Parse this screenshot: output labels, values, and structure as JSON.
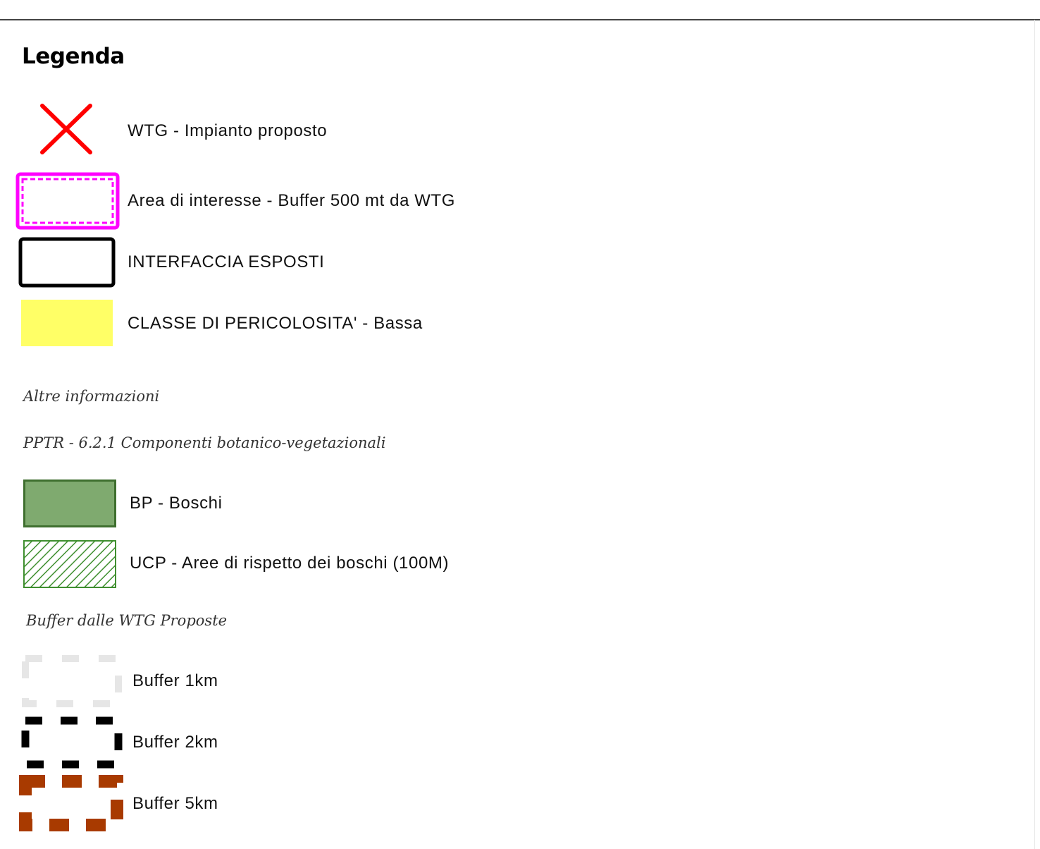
{
  "legend": {
    "title": "Legenda",
    "main_items": [
      {
        "label": "WTG - Impianto proposto",
        "icon": "red-x-icon",
        "color": "#ff0000"
      },
      {
        "label": "Area di interesse - Buffer 500 mt da WTG",
        "icon": "magenta-double-rectangle",
        "color": "#ff00ff"
      },
      {
        "label": "INTERFACCIA ESPOSTI",
        "icon": "black-outline-rectangle",
        "color": "#000000"
      },
      {
        "label": "CLASSE DI PERICOLOSITA' - Bassa",
        "icon": "yellow-fill-rectangle",
        "color": "#ffff66"
      }
    ],
    "other_info_heading": "Altre informazioni",
    "pptr_heading": "PPTR - 6.2.1 Componenti botanico-vegetazionali",
    "pptr_items": [
      {
        "label": "BP - Boschi",
        "icon": "green-fill-rectangle",
        "color": "#7faa6f",
        "border": "#3f6f2f"
      },
      {
        "label": "UCP - Aree di rispetto dei boschi (100M)",
        "icon": "green-hatched-rectangle",
        "color": "#3f8f2f"
      }
    ],
    "buffer_heading": "Buffer dalle WTG Proposte",
    "buffer_items": [
      {
        "label": "Buffer 1km",
        "icon": "dashed-light-gray-rectangle",
        "color": "#e8e8e8"
      },
      {
        "label": "Buffer 2km",
        "icon": "dashed-black-rectangle",
        "color": "#000000"
      },
      {
        "label": "Buffer 5km",
        "icon": "dashed-rust-rectangle",
        "color": "#a83a00"
      }
    ]
  }
}
